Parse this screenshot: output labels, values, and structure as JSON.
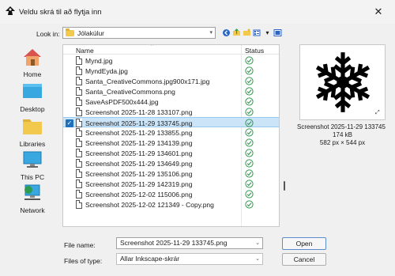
{
  "window": {
    "title": "Veldu skrá til að flytja inn",
    "close_glyph": "✕"
  },
  "lookin": {
    "label": "Look in:",
    "value": "Jólakúlur"
  },
  "places": [
    {
      "label": "Home",
      "icon": "home-icon"
    },
    {
      "label": "Desktop",
      "icon": "desktop-icon"
    },
    {
      "label": "Libraries",
      "icon": "libraries-icon"
    },
    {
      "label": "This PC",
      "icon": "this-pc-icon"
    },
    {
      "label": "Network",
      "icon": "network-icon"
    }
  ],
  "columns": {
    "name": "Name",
    "status": "Status"
  },
  "files": [
    {
      "name": "Mynd.jpg"
    },
    {
      "name": "MyndEyda.jpg"
    },
    {
      "name": "Santa_CreativeCommons.jpg900x171.jpg"
    },
    {
      "name": "Santa_CreativeCommons.png"
    },
    {
      "name": "SaveAsPDF500x444.jpg"
    },
    {
      "name": "Screenshot 2025-11-28 133107.png"
    },
    {
      "name": "Screenshot 2025-11-29 133745.png",
      "selected": true
    },
    {
      "name": "Screenshot 2025-11-29 133855.png"
    },
    {
      "name": "Screenshot 2025-11-29 134139.png"
    },
    {
      "name": "Screenshot 2025-11-29 134601.png"
    },
    {
      "name": "Screenshot 2025-11-29 134649.png"
    },
    {
      "name": "Screenshot 2025-11-29 135106.png"
    },
    {
      "name": "Screenshot 2025-11-29 142319.png"
    },
    {
      "name": "Screenshot 2025-12-02 115006.png"
    },
    {
      "name": "Screenshot 2025-12-02 121349 - Copy.png"
    }
  ],
  "preview": {
    "name": "Screenshot 2025-11-29 133745",
    "size": "174 kB",
    "dimensions": "582 px × 544 px"
  },
  "filename": {
    "label": "File name:",
    "value": "Screenshot 2025-11-29 133745.png"
  },
  "filetype": {
    "label": "Files of type:",
    "value": "Allar Inkscape-skrár"
  },
  "buttons": {
    "open": "Open",
    "cancel": "Cancel"
  },
  "colors": {
    "selection": "#cce4f7",
    "status_ok": "#2e9b4f",
    "accent": "#1f6fbf"
  }
}
